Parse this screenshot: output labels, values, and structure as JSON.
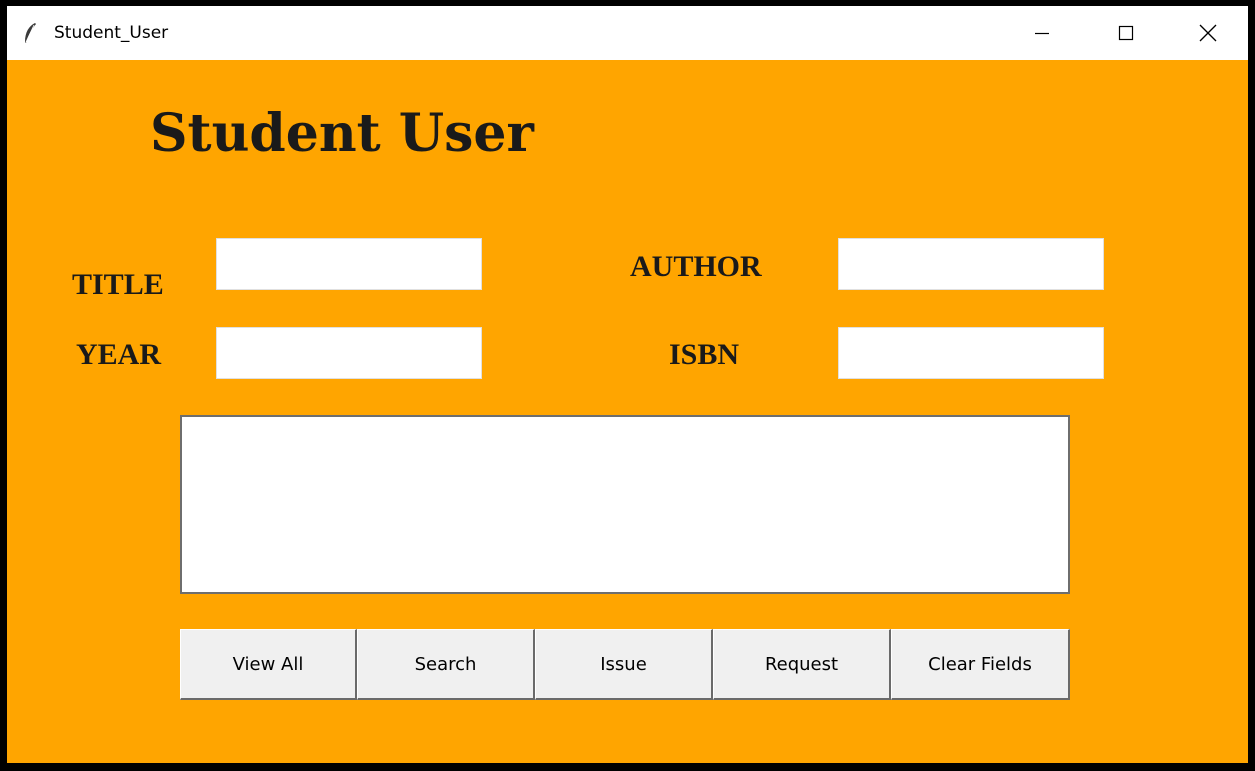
{
  "window": {
    "title": "Student_User",
    "background_color": "#ffa500",
    "controls": [
      "minimize-icon",
      "maximize-icon",
      "close-icon"
    ]
  },
  "heading": "Student User",
  "fields": {
    "title": {
      "label": "TITLE",
      "value": ""
    },
    "author": {
      "label": "AUTHOR",
      "value": ""
    },
    "year": {
      "label": "YEAR",
      "value": ""
    },
    "isbn": {
      "label": "ISBN",
      "value": ""
    }
  },
  "results_list": {
    "items": []
  },
  "buttons": {
    "view_all": "View All",
    "search": "Search",
    "issue": "Issue",
    "request": "Request",
    "clear_fields": "Clear Fields"
  }
}
